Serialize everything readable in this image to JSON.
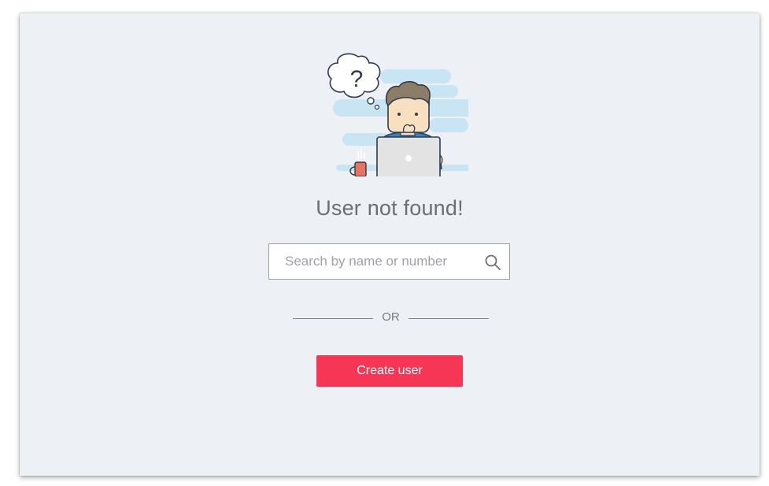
{
  "empty_state": {
    "title": "User not found!",
    "thought_symbol": "?"
  },
  "search": {
    "placeholder": "Search by name or number",
    "value": "",
    "icon": "search-icon"
  },
  "divider": {
    "label": "OR"
  },
  "actions": {
    "create_user_label": "Create user"
  },
  "colors": {
    "background": "#edf0f4",
    "accent": "#f73656",
    "title_text": "#6b6e73",
    "illustration_cloud": "#c9e4f2"
  }
}
